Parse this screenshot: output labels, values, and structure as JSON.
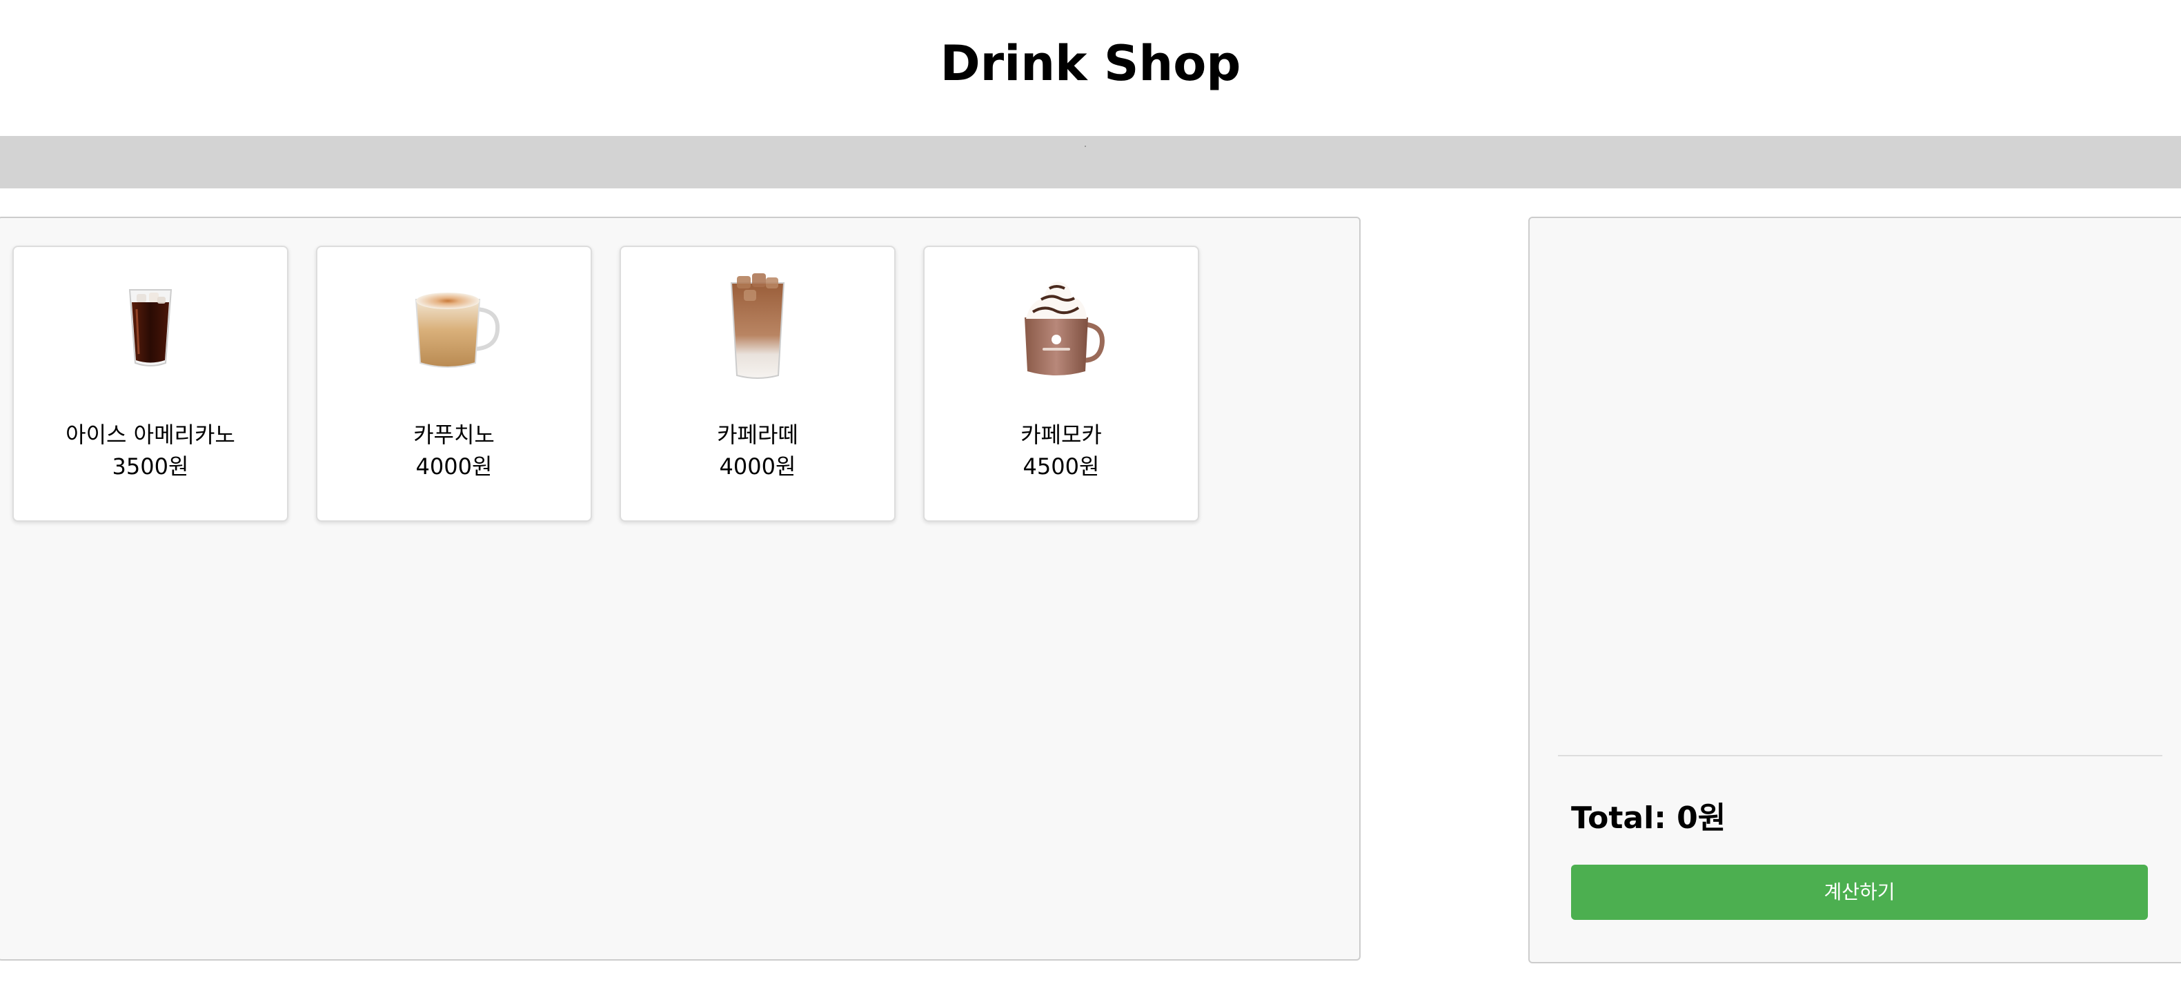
{
  "header": {
    "title": "Drink Shop"
  },
  "products": [
    {
      "name": "아이스 아메리카노",
      "price": "3500원",
      "icon": "iced-americano-image"
    },
    {
      "name": "카푸치노",
      "price": "4000원",
      "icon": "cappuccino-image"
    },
    {
      "name": "카페라떼",
      "price": "4000원",
      "icon": "iced-cafe-latte-image"
    },
    {
      "name": "카페모카",
      "price": "4500원",
      "icon": "cafe-mocha-image"
    }
  ],
  "cart": {
    "total_label": "Total:",
    "total_value": "0원",
    "checkout_label": "계산하기"
  },
  "colors": {
    "checkout_button": "#4caf50",
    "nav_bar": "#d3d3d3",
    "panel_background": "#f8f8f8"
  }
}
